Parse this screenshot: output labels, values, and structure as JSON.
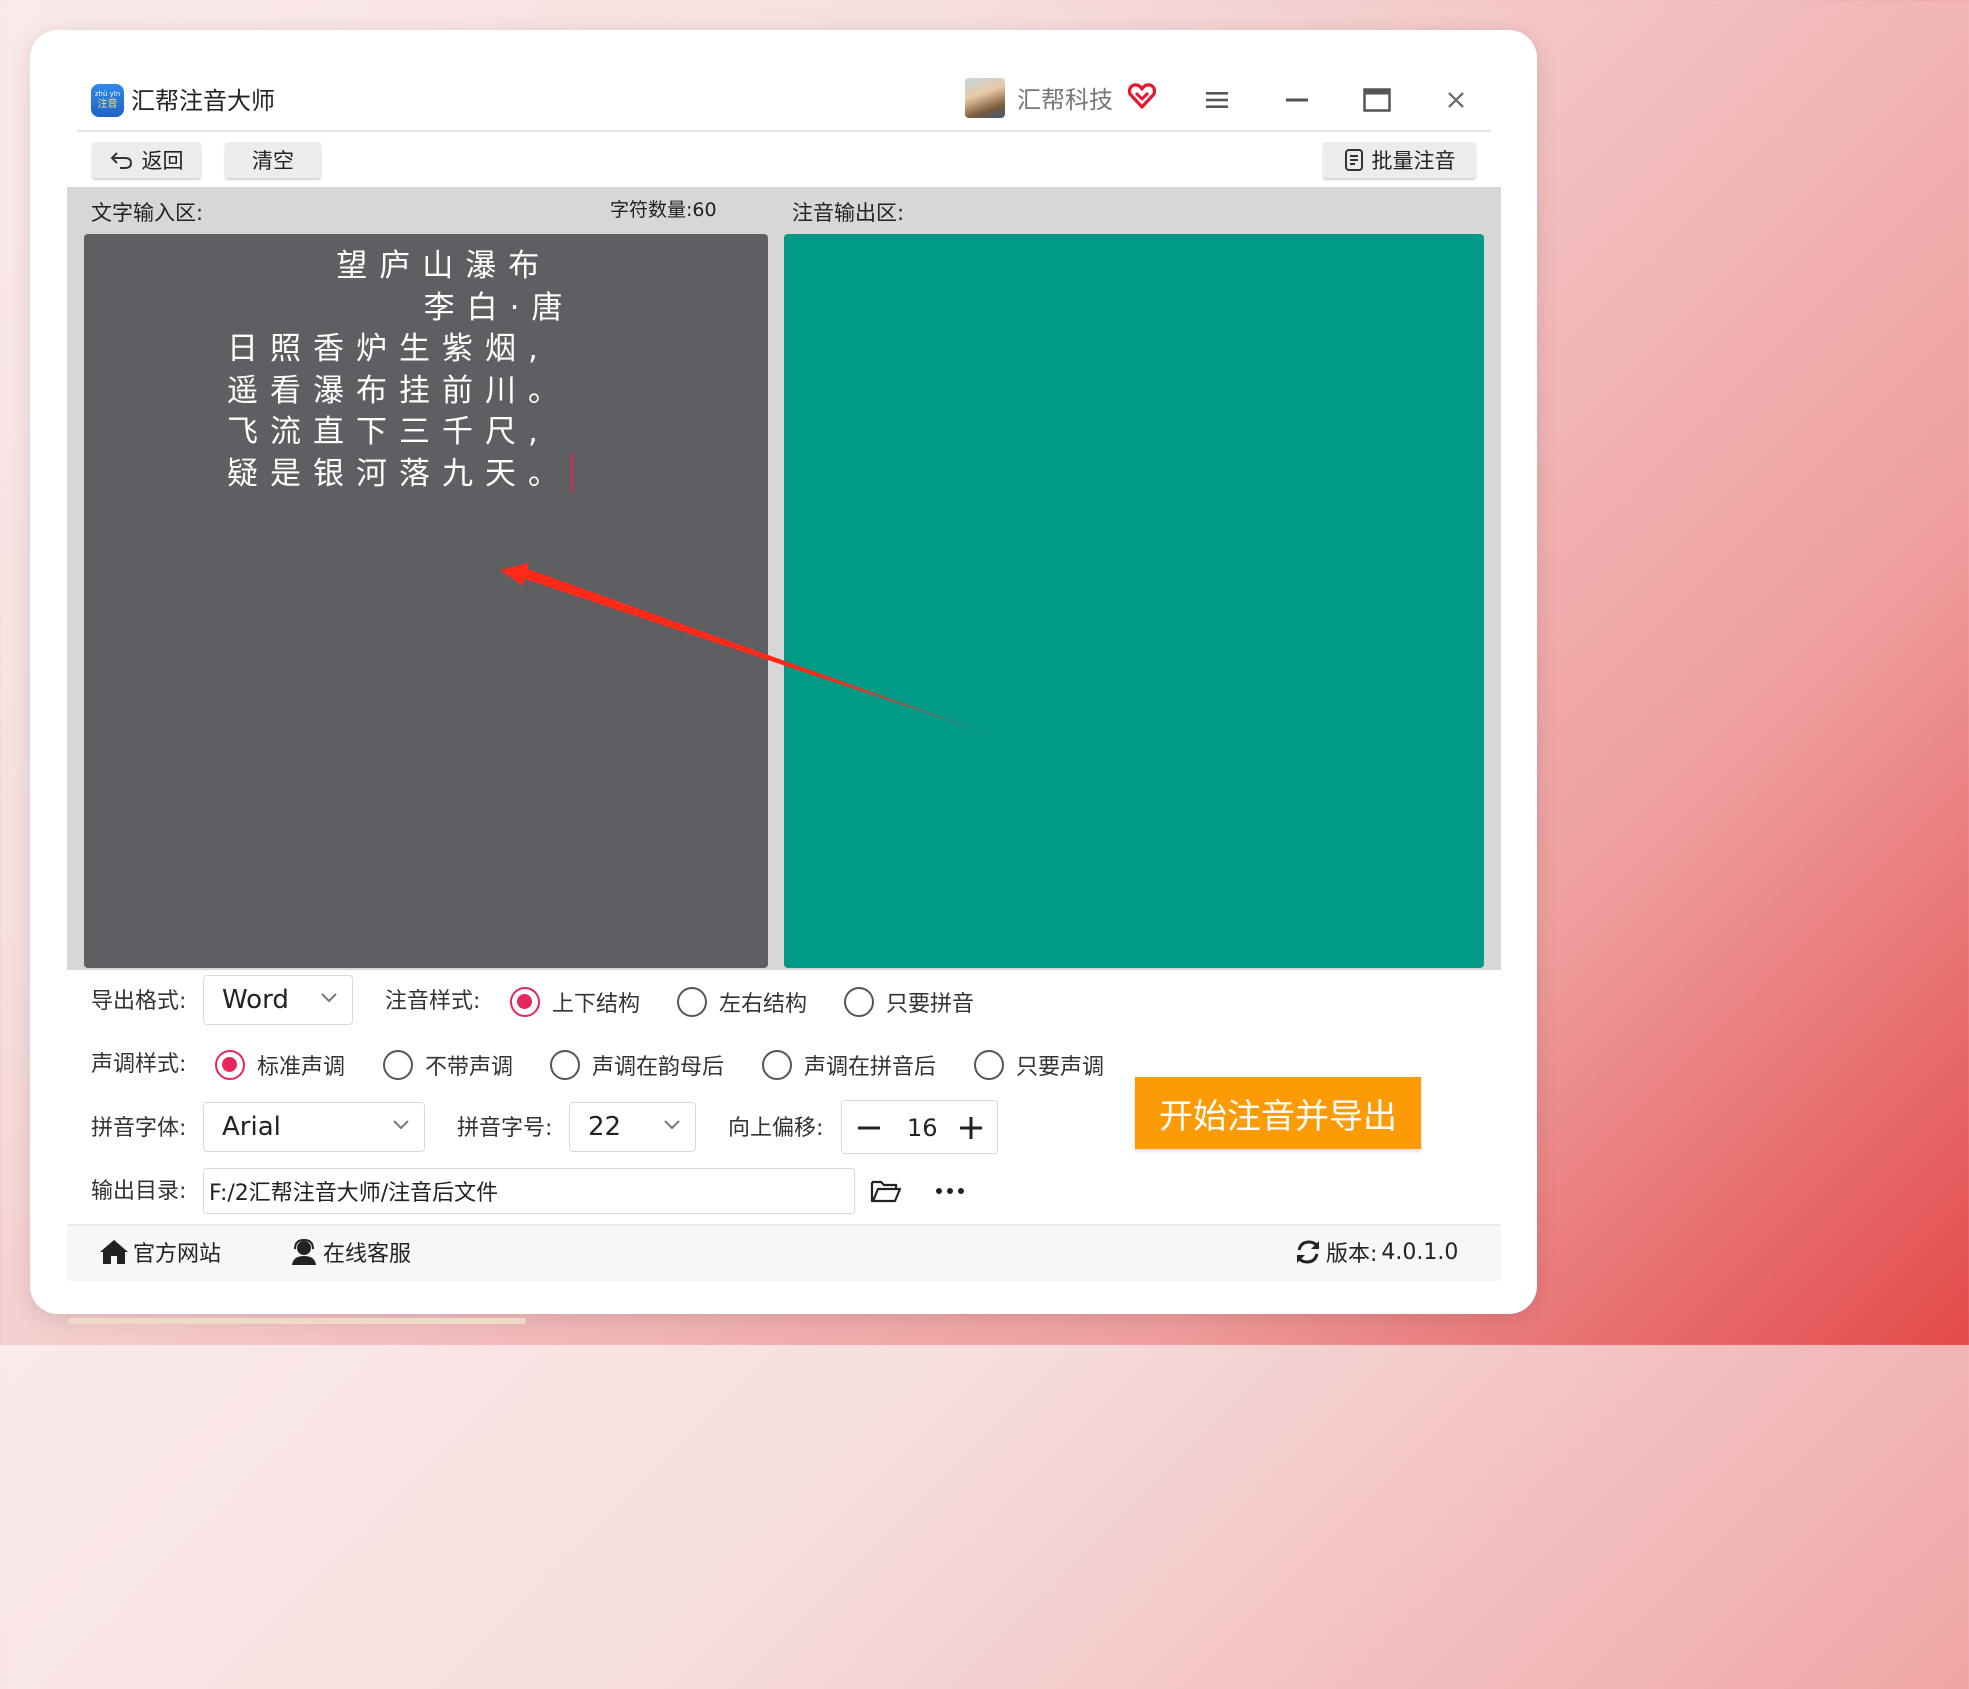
{
  "window": {
    "app_title": "汇帮注音大师",
    "logo_text_top": "zhù yīn",
    "logo_text_bottom": "注音",
    "user_name": "汇帮科技",
    "icons": [
      "menu-icon",
      "minimize-icon",
      "maximize-icon",
      "close-icon",
      "vip-heart-icon"
    ]
  },
  "toolbar": {
    "back_label": "返回",
    "clear_label": "清空",
    "batch_label": "批量注音"
  },
  "input_area": {
    "label": "文字输入区:",
    "char_count_label": "字符数量:",
    "char_count": "60",
    "lines": [
      "     望庐山瀑布",
      "         李白·唐",
      "日照香炉生紫烟,",
      "遥看瀑布挂前川。",
      "飞流直下三千尺,",
      "疑是银河落九天。"
    ]
  },
  "output_area": {
    "label": "注音输出区:"
  },
  "controls": {
    "export_format_label": "导出格式:",
    "export_format_value": "Word",
    "annotation_style_label": "注音样式:",
    "annotation_styles": [
      {
        "label": "上下结构",
        "selected": true
      },
      {
        "label": "左右结构",
        "selected": false
      },
      {
        "label": "只要拼音",
        "selected": false
      }
    ],
    "tone_style_label": "声调样式:",
    "tone_styles": [
      {
        "label": "标准声调",
        "selected": true
      },
      {
        "label": "不带声调",
        "selected": false
      },
      {
        "label": "声调在韵母后",
        "selected": false
      },
      {
        "label": "声调在拼音后",
        "selected": false
      },
      {
        "label": "只要声调",
        "selected": false
      }
    ],
    "pinyin_font_label": "拼音字体:",
    "pinyin_font_value": "Arial",
    "pinyin_size_label": "拼音字号:",
    "pinyin_size_value": "22",
    "offset_label": "向上偏移:",
    "offset_value": "16",
    "start_button": "开始注音并导出",
    "output_dir_label": "输出目录:",
    "output_dir_value": "F:/2汇帮注音大师/注音后文件"
  },
  "footer": {
    "website_label": "官方网站",
    "support_label": "在线客服",
    "version_label": "版本:",
    "version_value": "4.0.1.0"
  },
  "colors": {
    "input_bg": "#5e5f63",
    "output_bg": "#009a87",
    "accent": "#e8265e",
    "start_button": "#fc9b06",
    "arrow": "#ff2a1a"
  }
}
